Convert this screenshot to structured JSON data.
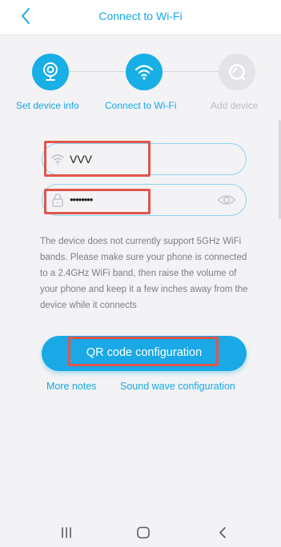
{
  "header": {
    "title": "Connect to Wi-Fi"
  },
  "steps": [
    {
      "label": "Set device info",
      "state": "active",
      "icon": "camera-icon"
    },
    {
      "label": "Connect to Wi-Fi",
      "state": "active",
      "icon": "wifi-icon"
    },
    {
      "label": "Add device",
      "state": "inactive",
      "icon": "search-icon"
    }
  ],
  "wifi_field": {
    "value": "VVV",
    "icon": "wifi-icon"
  },
  "password_field": {
    "value": "••••••••",
    "icon": "lock-icon",
    "toggle_icon": "eye-icon"
  },
  "notice": "The device does not currently support 5GHz WiFi bands. Please make sure your phone is connected to a 2.4GHz WiFi band, then raise the volume of your phone and keep it a few inches away from the device while it connects",
  "primary_button": {
    "label": "QR code configuration"
  },
  "links": {
    "more_notes": "More notes",
    "sound_wave": "Sound wave configuration"
  },
  "colors": {
    "accent": "#17a8e3",
    "highlight": "#e0554b",
    "inactive": "#b9bec4"
  },
  "navbar": {
    "icons": [
      "recent-apps-icon",
      "home-icon",
      "back-icon"
    ]
  }
}
